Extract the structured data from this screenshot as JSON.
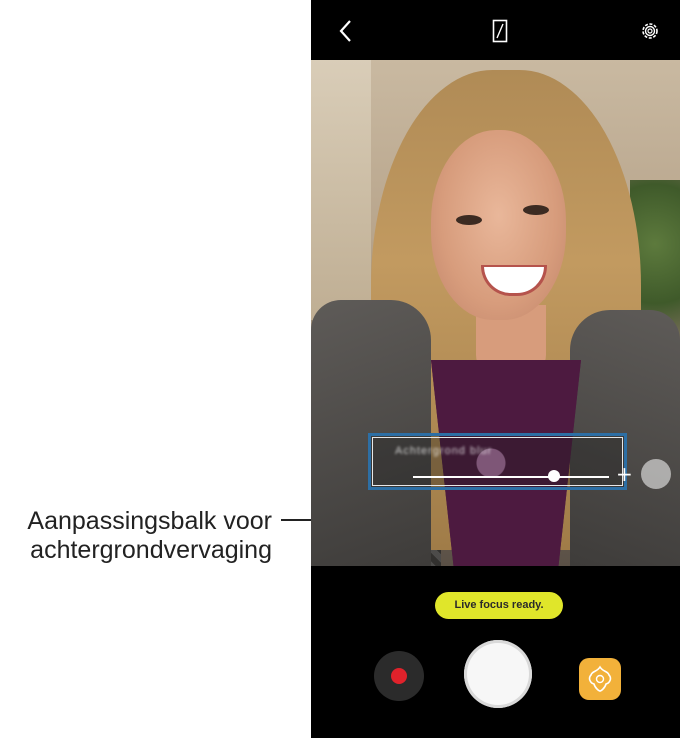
{
  "callout": {
    "line1": "Aanpassingsbalk voor",
    "line2": "achtergrondvervaging"
  },
  "camera": {
    "blur_slider": {
      "label": "Achtergrond blur",
      "level": 0.72
    },
    "status_text": "Live focus ready.",
    "colors": {
      "status_pill": "#e0e62a",
      "highlight_frame": "#2d6fa5",
      "record_dot": "#e0222b",
      "effects_button": "#f2b13a"
    },
    "icons": [
      "back-icon",
      "aspect-ratio-icon",
      "settings-gear-icon",
      "plus-icon",
      "effect-sparkle-icon",
      "record-icon",
      "shutter-icon",
      "beauty-effects-icon"
    ]
  }
}
